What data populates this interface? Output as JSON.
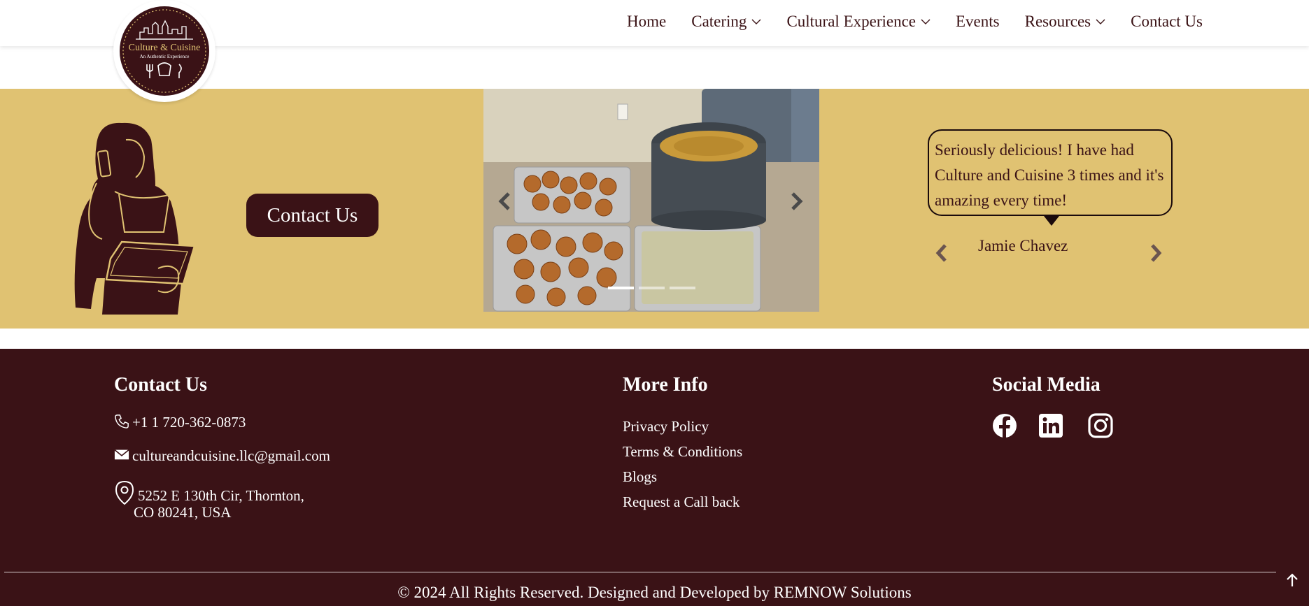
{
  "header": {
    "logo_title": "Culture & Cuisine",
    "logo_tagline": "An Authentic Experience",
    "nav": [
      {
        "label": "Home"
      },
      {
        "label": "Catering"
      },
      {
        "label": "Cultural Experience"
      },
      {
        "label": "Events"
      },
      {
        "label": "Resources"
      },
      {
        "label": "Contact Us"
      }
    ]
  },
  "hero": {
    "contact_button": "Contact Us",
    "carousel": {
      "slide_count": 3,
      "active_slide": 1
    },
    "testimonial": {
      "quote": "Seriously delicious! I have had Culture and Cuisine 3 times and it's amazing every time!",
      "author": "Jamie Chavez"
    }
  },
  "footer": {
    "contact": {
      "heading": "Contact Us",
      "phone": "+1 1 720-362-0873",
      "email": "cultureandcuisine.llc@gmail.com",
      "address_line1": "5252 E 130th Cir, Thornton,",
      "address_line2": "CO 80241, USA"
    },
    "more_info": {
      "heading": "More Info",
      "links": [
        "Privacy Policy",
        "Terms & Conditions",
        "Blogs",
        "Request a Call back"
      ]
    },
    "social": {
      "heading": "Social Media",
      "icons": [
        "facebook-icon",
        "linkedin-icon",
        "instagram-icon"
      ]
    },
    "copyright": "© 2024 All Rights Reserved. Designed and Developed by REMNOW Solutions"
  },
  "colors": {
    "brand_dark": "#3a1216",
    "gold": "#e0c272",
    "white": "#ffffff"
  }
}
